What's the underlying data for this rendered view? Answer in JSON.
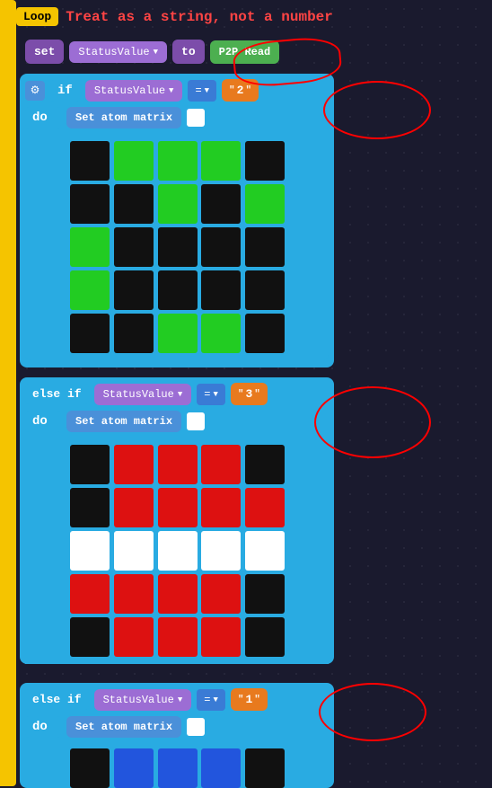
{
  "header": {
    "loop_label": "Loop",
    "title": "Treat as a string, not a number"
  },
  "set_block": {
    "set_label": "set",
    "variable_label": "StatusValue",
    "to_label": "to",
    "p2p_label": "P2P Read"
  },
  "if_block": {
    "if_label": "if",
    "variable_label": "StatusValue",
    "equals_label": "=",
    "value_1": "2",
    "do_label": "do",
    "set_atom_label": "Set atom matrix"
  },
  "elseif_2": {
    "elseif_label": "else if",
    "variable_label": "StatusValue",
    "equals_label": "=",
    "value": "3",
    "do_label": "do",
    "set_atom_label": "Set atom matrix"
  },
  "elseif_3": {
    "elseif_label": "else if",
    "variable_label": "StatusValue",
    "equals_label": "=",
    "value": "1",
    "do_label": "do",
    "set_atom_label": "Set atom matrix"
  },
  "matrix_1": {
    "rows": [
      [
        "black",
        "green",
        "green",
        "green",
        "black"
      ],
      [
        "black",
        "black",
        "green",
        "black",
        "green"
      ],
      [
        "green",
        "black",
        "black",
        "black",
        "black"
      ],
      [
        "green",
        "black",
        "black",
        "black",
        "black"
      ],
      [
        "black",
        "black",
        "green",
        "green",
        "black"
      ]
    ]
  },
  "matrix_2": {
    "rows": [
      [
        "black",
        "red",
        "red",
        "red",
        "black"
      ],
      [
        "black",
        "red",
        "red",
        "red",
        "red"
      ],
      [
        "white",
        "white",
        "white",
        "white",
        "white"
      ],
      [
        "red",
        "red",
        "red",
        "red",
        "black"
      ],
      [
        "black",
        "red",
        "red",
        "red",
        "black"
      ]
    ]
  },
  "matrix_3": {
    "rows": [
      [
        "black",
        "blue",
        "blue",
        "blue",
        "black"
      ]
    ]
  },
  "colors": {
    "accent": "#29abe2",
    "loop_yellow": "#f5c400",
    "title_red": "#ff4444",
    "variable_purple": "#9c6dd4",
    "string_orange": "#e87a1e",
    "green": "#22cc22",
    "red": "#dd1111"
  }
}
